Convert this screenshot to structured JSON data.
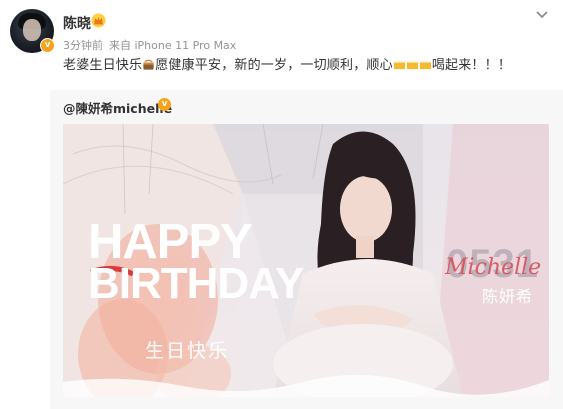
{
  "post": {
    "author": "陈晓",
    "time": "3分钟前",
    "source": "来自 iPhone 11 Pro Max",
    "text_part1": "老婆生日快乐",
    "text_part2": "愿健康平安，新的一岁，一切顺利，顺心",
    "text_part3": "喝起来！！！"
  },
  "retweet": {
    "author": "@陳妍希michelle",
    "image": {
      "happy": "HAPPY",
      "birthday": "BIRTHDAY",
      "cn_birthday": "生日快乐",
      "date": "0531",
      "signature": "Michelle",
      "cn_name": "陈妍希"
    }
  },
  "colors": {
    "accent": "#f8a21b",
    "signature": "#d6505a"
  },
  "icons": [
    "avatar-verified-badge",
    "crown-icon",
    "chevron-down-icon",
    "cake-icon",
    "beer-icon",
    "verified-icon"
  ]
}
